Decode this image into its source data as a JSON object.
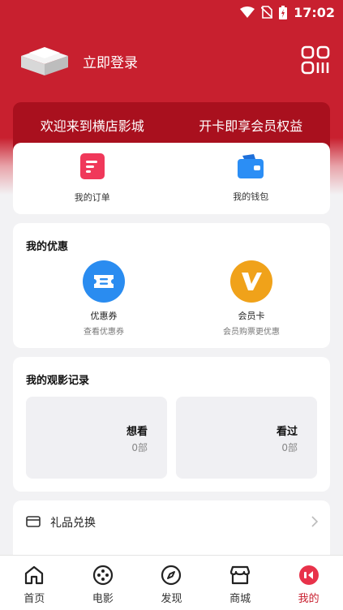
{
  "status_bar": {
    "time": "17:02"
  },
  "header": {
    "login_text": "立即登录"
  },
  "banner": {
    "left_text": "欢迎来到横店影城",
    "right_text": "开卡即享会员权益"
  },
  "quick_actions": [
    {
      "label": "我的订单",
      "icon": "order-icon"
    },
    {
      "label": "我的钱包",
      "icon": "wallet-icon"
    }
  ],
  "promotions": {
    "title": "我的优惠",
    "items": [
      {
        "name": "优惠券",
        "sub": "查看优惠券",
        "icon": "ticket-icon",
        "color": "#2a8cf0"
      },
      {
        "name": "会员卡",
        "sub": "会员购票更优惠",
        "icon": "v-badge-icon",
        "color": "#f0a21a"
      }
    ]
  },
  "history": {
    "title": "我的观影记录",
    "items": [
      {
        "label": "想看",
        "count": "0部"
      },
      {
        "label": "看过",
        "count": "0部"
      }
    ]
  },
  "gift": {
    "label": "礼品兑换"
  },
  "tabs": [
    {
      "label": "首页",
      "icon": "home-icon"
    },
    {
      "label": "电影",
      "icon": "film-reel-icon"
    },
    {
      "label": "发现",
      "icon": "compass-icon"
    },
    {
      "label": "商城",
      "icon": "store-icon"
    },
    {
      "label": "我的",
      "icon": "profile-icon",
      "active": true
    }
  ],
  "colors": {
    "brand": "#c8202f",
    "banner": "#a9101e"
  }
}
